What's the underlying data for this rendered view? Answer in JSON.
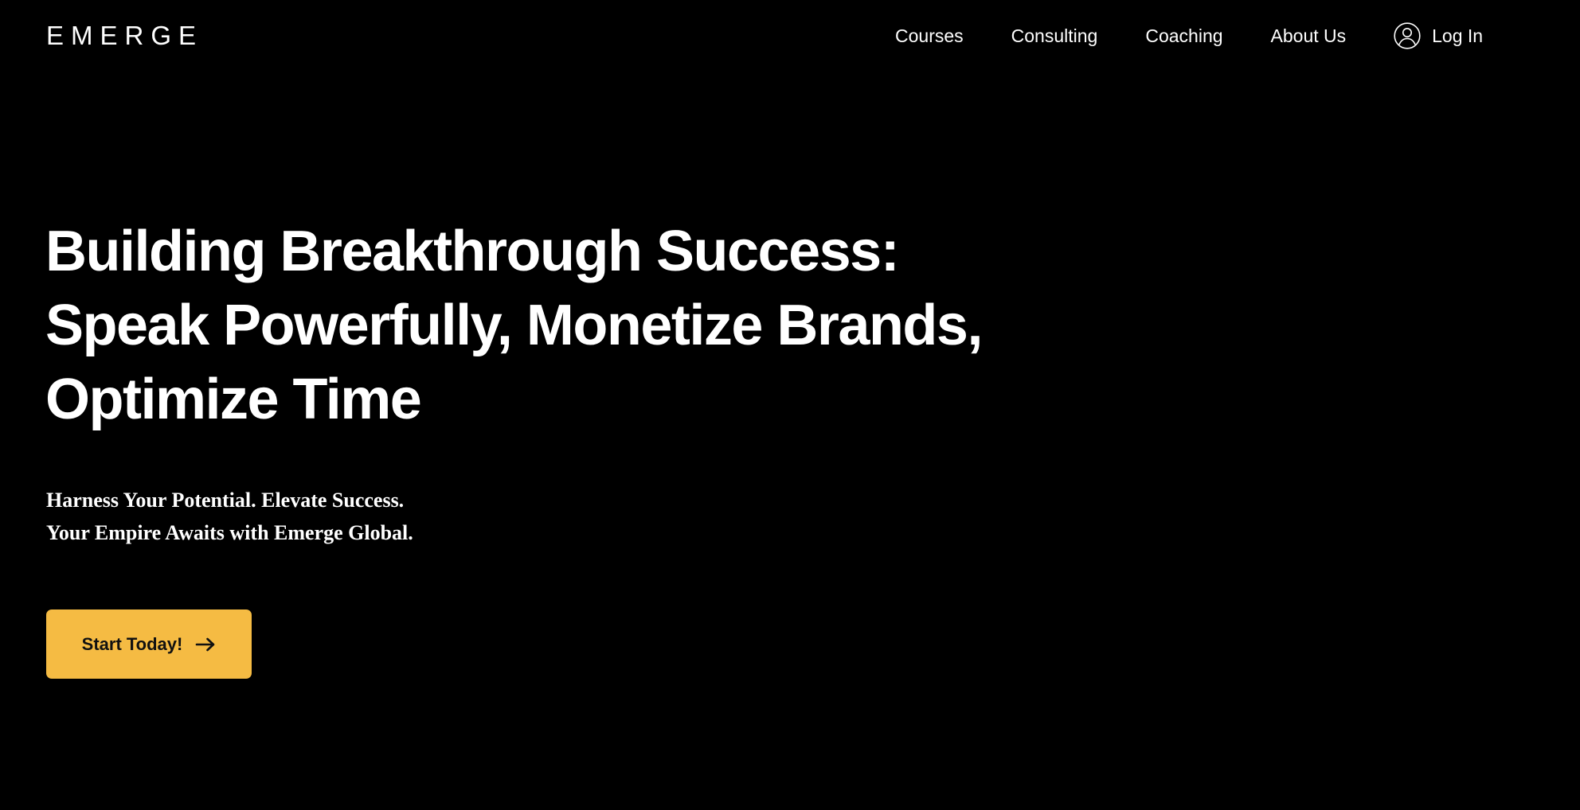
{
  "header": {
    "logo_text": "EMERGE",
    "nav": [
      {
        "label": "Courses"
      },
      {
        "label": "Consulting"
      },
      {
        "label": "Coaching"
      },
      {
        "label": "About Us"
      }
    ],
    "login": {
      "label": "Log In",
      "icon": "user-circle-icon"
    }
  },
  "hero": {
    "title_lines": [
      "Building Breakthrough Success:",
      "Speak Powerfully, Monetize Brands,",
      "Optimize Time"
    ],
    "tagline_lines": [
      "Harness Your Potential. Elevate Success.",
      "Your Empire Awaits with Emerge Global."
    ],
    "cta": {
      "label": "Start Today!",
      "icon": "arrow-right-icon"
    }
  },
  "colors": {
    "background": "#000000",
    "text": "#ffffff",
    "accent": "#f5bb43",
    "cta_text": "#111111"
  }
}
